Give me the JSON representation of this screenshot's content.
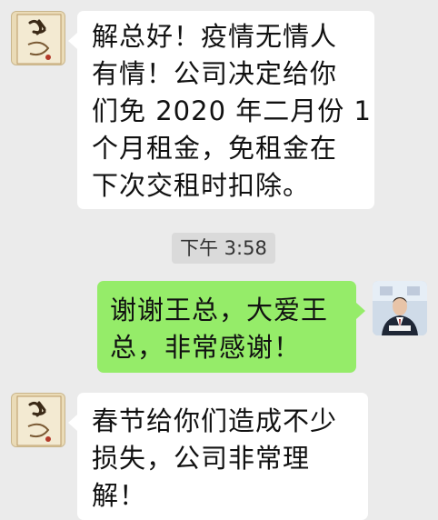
{
  "messages": [
    {
      "side": "left",
      "avatar": "calligraphy-scroll-avatar",
      "text": "解总好！疫情无情人\n有情！公司决定给你\n们免 2020 年二月份 1\n个月租金，免租金在\n下次交租时扣除。"
    },
    {
      "side": "right",
      "avatar": "man-in-suit-avatar",
      "text": "谢谢王总，大爱王\n总，非常感谢！"
    },
    {
      "side": "left",
      "avatar": "calligraphy-scroll-avatar",
      "text": "春节给你们造成不少\n损失，公司非常理\n解！"
    }
  ],
  "timestamp": "下午 3:58",
  "colors": {
    "background": "#ebebeb",
    "incoming_bubble": "#ffffff",
    "outgoing_bubble": "#95ec69",
    "timestamp_pill": "#dadada"
  }
}
